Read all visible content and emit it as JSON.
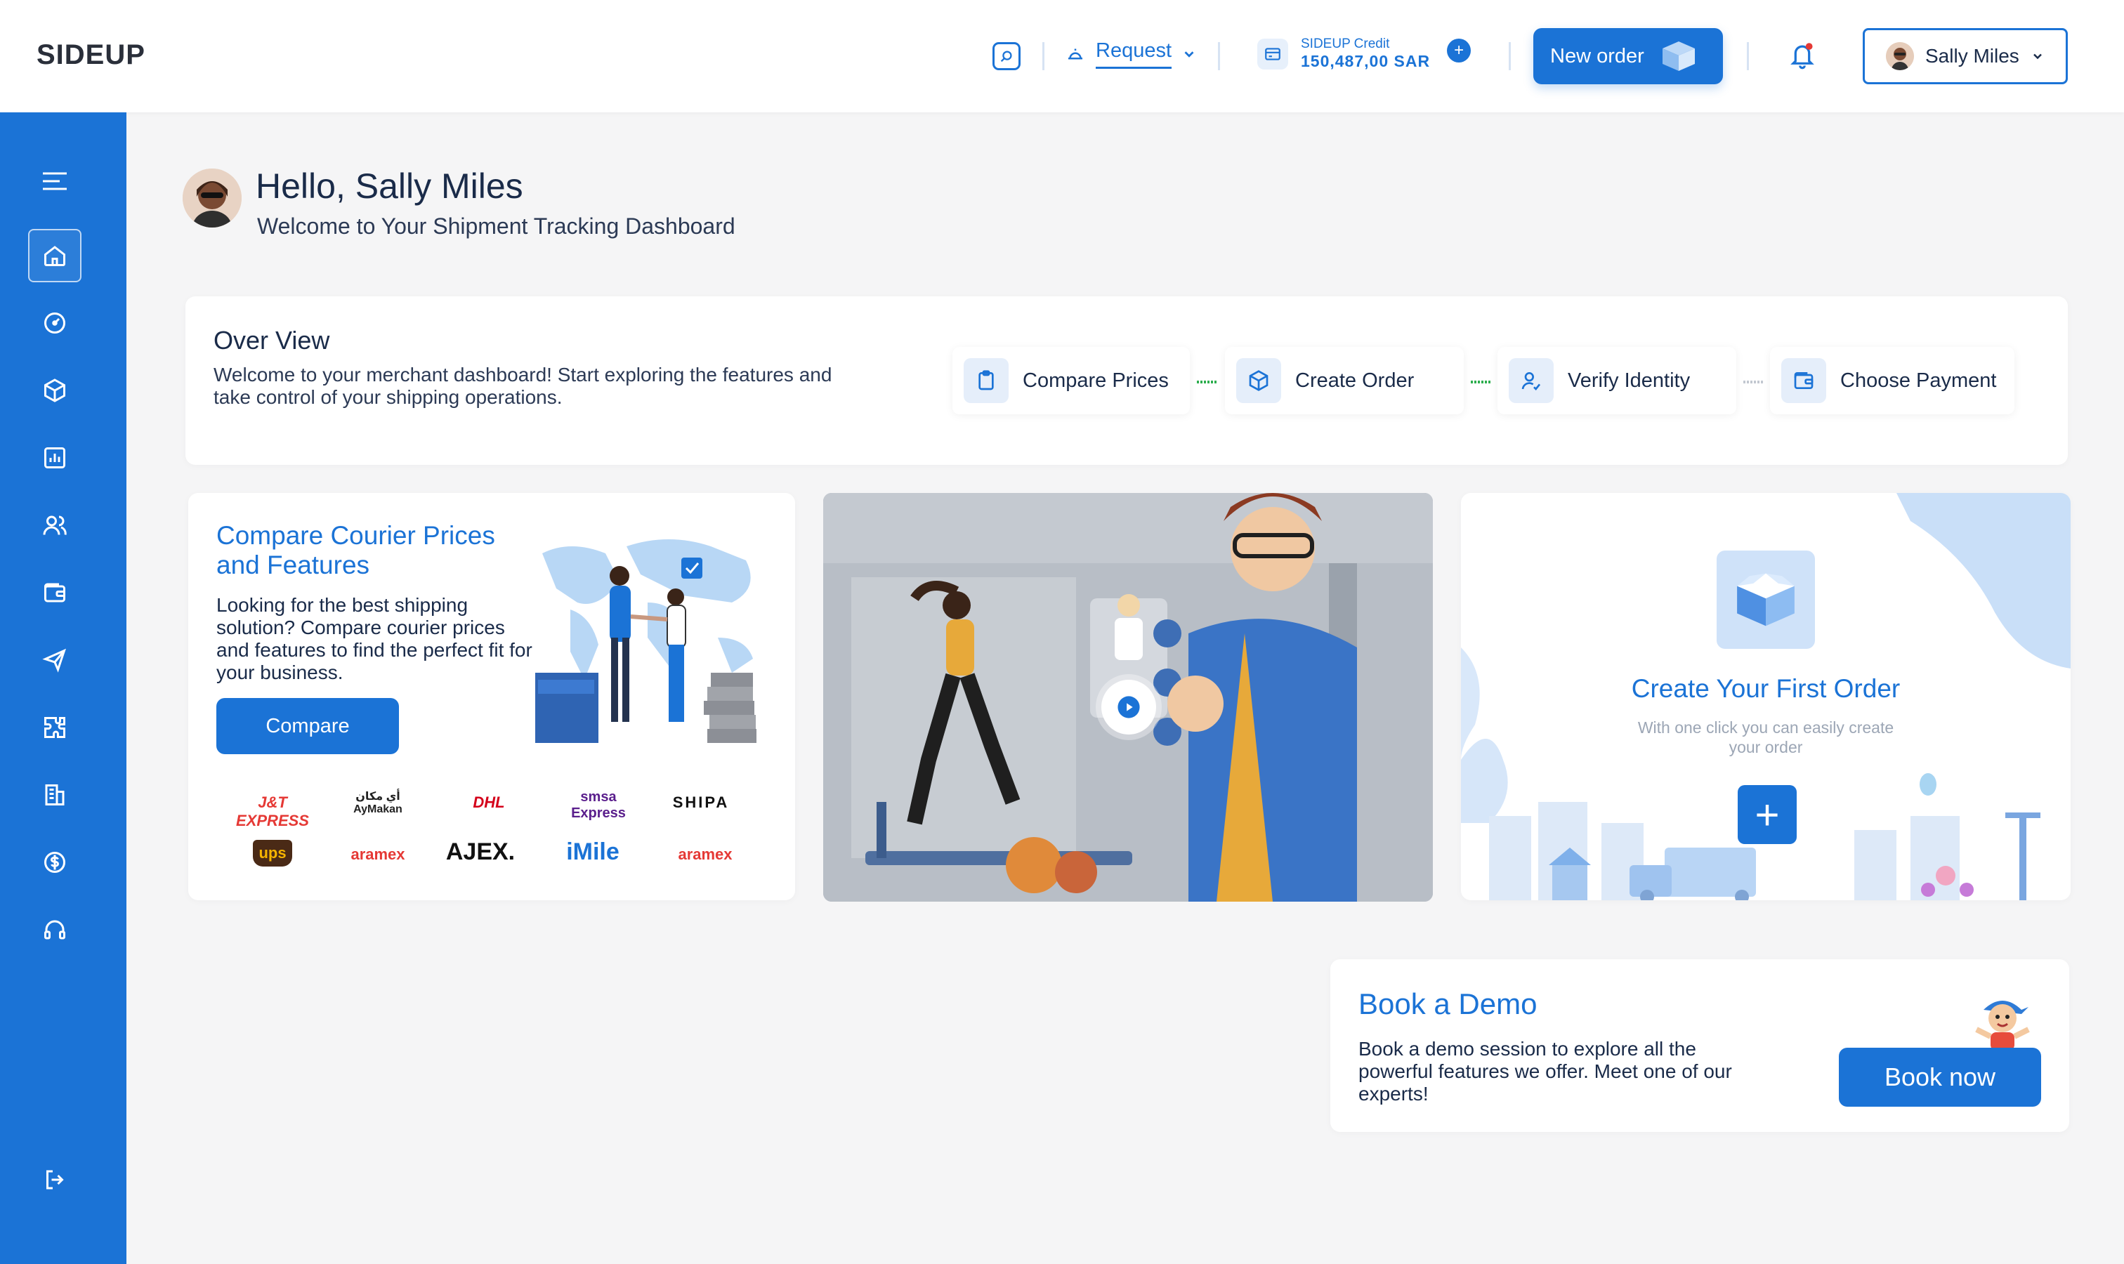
{
  "header": {
    "logo": "SIDEUP",
    "request_label": "Request",
    "credit_label": "SIDEUP Credit",
    "credit_value": "150,487,00 SAR",
    "new_order_label": "New order",
    "user_name": "Sally Miles"
  },
  "sidebar": {
    "items": [
      "menu-icon",
      "home-icon",
      "dashboard-gauge-icon",
      "package-icon",
      "reports-icon",
      "users-icon",
      "wallet-icon",
      "send-icon",
      "integrations-icon",
      "building-icon",
      "billing-icon",
      "support-icon",
      "logout-icon"
    ],
    "active": "home-icon"
  },
  "greeting": {
    "title": "Hello, Sally Miles",
    "subtitle": "Welcome to Your Shipment Tracking Dashboard"
  },
  "overview": {
    "title": "Over View",
    "description": "Welcome to your merchant dashboard! Start exploring the features and take control of your shipping operations.",
    "steps": [
      "Compare Prices",
      "Create Order",
      "Verify Identity",
      "Choose Payment"
    ]
  },
  "compare": {
    "title": "Compare Courier Prices and Features",
    "description": "Looking for the best shipping solution? Compare courier prices and features to find the perfect fit for your business.",
    "button": "Compare",
    "couriers": [
      "J&T EXPRESS",
      "أي مكان AyMakan",
      "DHL",
      "smsa Express",
      "SHIPA",
      "ups",
      "aramex",
      "AJEX.",
      "iMile",
      "aramex"
    ]
  },
  "create_order": {
    "title": "Create Your First Order",
    "subtitle": "With one click you can easily create your order"
  },
  "demo": {
    "title": "Book a Demo",
    "description": "Book a demo session to explore all the powerful features we offer. Meet one of our experts!",
    "button": "Book now"
  },
  "colors": {
    "primary": "#1b73d6",
    "background": "#f5f5f6",
    "text": "#1a2b49"
  }
}
